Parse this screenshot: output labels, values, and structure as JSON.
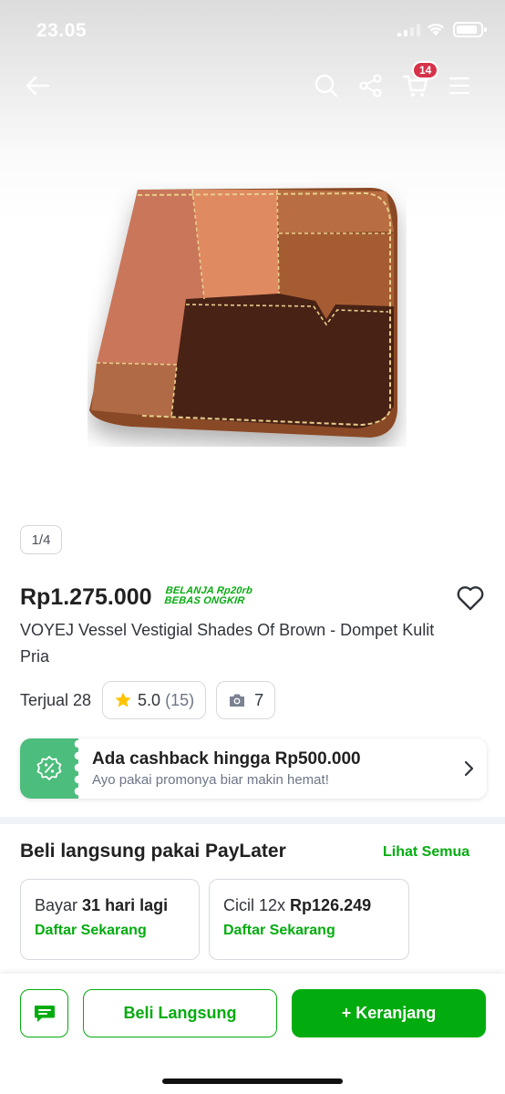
{
  "status_bar": {
    "time": "23.05"
  },
  "top_bar": {
    "cart_count": "14"
  },
  "gallery": {
    "page_indicator": "1/4"
  },
  "product": {
    "price": "Rp1.275.000",
    "promo_line1": "BELANJA Rp20rb",
    "promo_line2": "BEBAS ONGKIR",
    "title": "VOYEJ Vessel Vestigial Shades Of Brown - Dompet Kulit Pria",
    "sold": "Terjual 28",
    "rating": "5.0",
    "review_count": "(15)",
    "photo_count": "7"
  },
  "cashback": {
    "title": "Ada cashback hingga Rp500.000",
    "subtitle": "Ayo pakai promonya biar makin hemat!"
  },
  "paylater": {
    "title": "Beli langsung pakai PayLater",
    "see_all": "Lihat Semua",
    "options": [
      {
        "prefix": "Bayar",
        "bold": "31 hari lagi",
        "cta": "Daftar Sekarang"
      },
      {
        "prefix": "Cicil 12x",
        "bold": "Rp126.249",
        "cta": "Daftar Sekarang"
      }
    ]
  },
  "bottom_bar": {
    "buy_now": "Beli Langsung",
    "add_to_cart": "+ Keranjang"
  },
  "colors": {
    "brand_green": "#03ac0e",
    "badge_red": "#d6324a",
    "cashback_green": "#4cbd7c",
    "star_yellow": "#ffc400"
  }
}
